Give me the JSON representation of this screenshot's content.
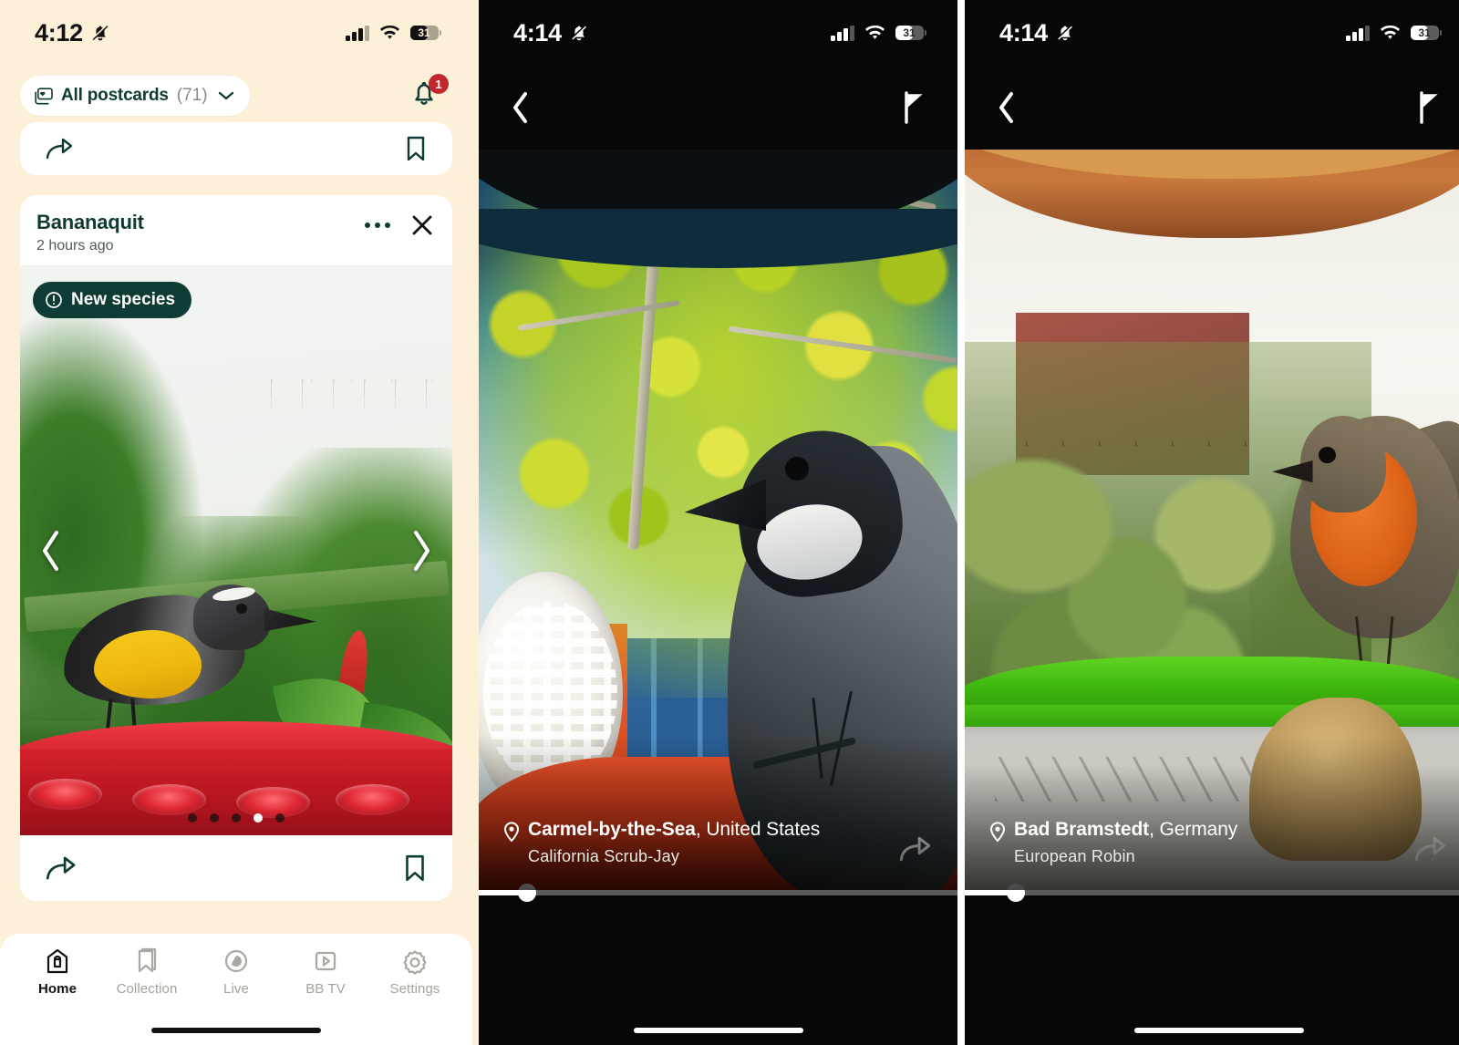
{
  "left": {
    "status": {
      "time": "4:12",
      "battery": "31",
      "mute_icon": "bell-slash-icon"
    },
    "toolbar": {
      "filter_label": "All postcards",
      "filter_count": "(71)",
      "filter_icon": "postcards-icon",
      "chevron_icon": "chevron-down-icon",
      "bell_icon": "bell-icon",
      "bell_badge": "1"
    },
    "peek_card": {
      "share_icon": "share-icon",
      "bookmark_icon": "bookmark-icon"
    },
    "card": {
      "title": "Bananaquit",
      "timestamp": "2 hours ago",
      "more_icon": "more-horizontal-icon",
      "close_icon": "close-icon",
      "badge_label": "New species",
      "badge_icon": "exclamation-circle-icon",
      "prev_icon": "chevron-left-icon",
      "next_icon": "chevron-right-icon",
      "share_icon": "share-icon",
      "bookmark_icon": "bookmark-icon",
      "carousel_dots": 5,
      "carousel_active_index": 3
    },
    "tabs": [
      {
        "label": "Home",
        "icon": "home-icon",
        "active": true
      },
      {
        "label": "Collection",
        "icon": "bookmark-icon",
        "active": false
      },
      {
        "label": "Live",
        "icon": "live-icon",
        "active": false
      },
      {
        "label": "BB TV",
        "icon": "play-rect-icon",
        "active": false
      },
      {
        "label": "Settings",
        "icon": "gear-icon",
        "active": false
      }
    ]
  },
  "middle": {
    "status": {
      "time": "4:14",
      "battery": "31",
      "mute_icon": "bell-slash-icon"
    },
    "nav": {
      "back_icon": "chevron-left-icon",
      "flag_icon": "flag-icon"
    },
    "caption": {
      "pin_icon": "location-pin-icon",
      "city": "Carmel-by-the-Sea",
      "country": ", United States",
      "species": "California Scrub-Jay",
      "share_icon": "share-icon"
    },
    "scrubber": {
      "progress_percent": 10
    }
  },
  "right": {
    "status": {
      "time": "4:14",
      "battery": "31",
      "mute_icon": "bell-slash-icon"
    },
    "nav": {
      "back_icon": "chevron-left-icon",
      "flag_icon": "flag-icon"
    },
    "caption": {
      "pin_icon": "location-pin-icon",
      "city": "Bad Bramstedt",
      "country": ", Germany",
      "species": "European Robin",
      "share_icon": "share-icon"
    },
    "scrubber": {
      "progress_percent": 10
    }
  },
  "colors": {
    "cream": "#FDF0D8",
    "brand_green": "#0E3B33",
    "badge_red": "#C2262E",
    "dark_bg": "#070707"
  }
}
